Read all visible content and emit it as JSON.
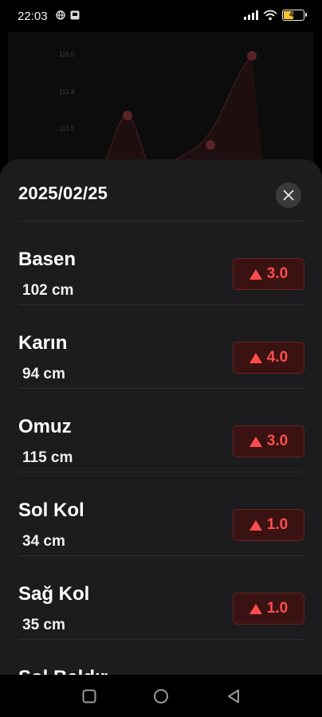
{
  "status_bar": {
    "time": "22:03",
    "battery_level": "47",
    "colors": {
      "battery_fill": "#f2c233"
    }
  },
  "background_chart": {
    "y_tick_labels": [
      "115.0",
      "112.8",
      "113.5"
    ]
  },
  "sheet": {
    "title": "2025/02/25",
    "close_icon": "close-icon",
    "rows": [
      {
        "name": "Basen",
        "value": "102 cm",
        "change": "3.0",
        "direction": "up"
      },
      {
        "name": "Karın",
        "value": "94 cm",
        "change": "4.0",
        "direction": "up"
      },
      {
        "name": "Omuz",
        "value": "115 cm",
        "change": "3.0",
        "direction": "up"
      },
      {
        "name": "Sol Kol",
        "value": "34 cm",
        "change": "1.0",
        "direction": "up"
      },
      {
        "name": "Sağ Kol",
        "value": "35 cm",
        "change": "1.0",
        "direction": "up"
      },
      {
        "name": "Sol Baldır",
        "value": "",
        "change": "",
        "direction": ""
      }
    ],
    "colors": {
      "background": "#1c1c1e",
      "increase": "#ff4d4d",
      "badge_background": "#3a1212"
    }
  },
  "nav_bar": {
    "buttons": [
      "recents-icon",
      "home-icon",
      "back-icon"
    ]
  }
}
